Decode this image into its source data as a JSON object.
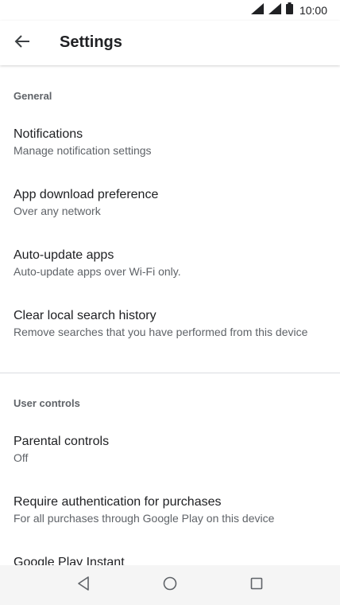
{
  "status_bar": {
    "time": "10:00",
    "icons": [
      "wifi-icon",
      "signal-icon",
      "battery-icon"
    ]
  },
  "app_bar": {
    "title": "Settings",
    "back_icon": "arrow-back-icon"
  },
  "sections": [
    {
      "header": "General",
      "items": [
        {
          "title": "Notifications",
          "subtitle": "Manage notification settings"
        },
        {
          "title": "App download preference",
          "subtitle": "Over any network"
        },
        {
          "title": "Auto-update apps",
          "subtitle": "Auto-update apps over Wi-Fi only."
        },
        {
          "title": "Clear local search history",
          "subtitle": "Remove searches that you have performed from this device"
        }
      ]
    },
    {
      "header": "User controls",
      "items": [
        {
          "title": "Parental controls",
          "subtitle": "Off"
        },
        {
          "title": "Require authentication for purchases",
          "subtitle": "For all purchases through Google Play on this device"
        },
        {
          "title": "Google Play Instant",
          "subtitle": ""
        }
      ]
    }
  ],
  "nav_bar": {
    "buttons": [
      "back-triangle-icon",
      "home-circle-icon",
      "recents-square-icon"
    ]
  },
  "colors": {
    "text_primary": "#202124",
    "text_secondary": "#5f6368",
    "divider": "#dadce0",
    "nav_background": "#f5f5f5"
  }
}
